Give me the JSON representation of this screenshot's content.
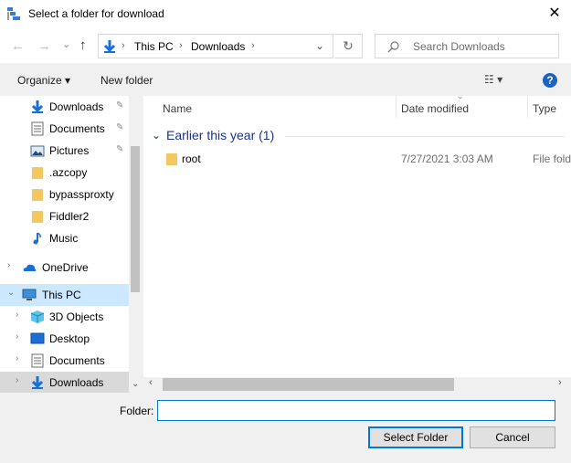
{
  "window": {
    "title": "Select a folder for download",
    "close_glyph": "✕"
  },
  "nav": {
    "back_glyph": "←",
    "forward_glyph": "→",
    "recent_glyph": "⌄",
    "up_glyph": "↑",
    "breadcrumb": [
      "This PC",
      "Downloads"
    ],
    "dropdown_glyph": "⌄",
    "refresh_glyph": "↻",
    "search_placeholder": "Search Downloads"
  },
  "commands": {
    "organize": "Organize ▾",
    "new_folder": "New folder",
    "view_glyph": "☷ ▾",
    "help": "?"
  },
  "sidebar": {
    "items": [
      {
        "label": "Downloads",
        "icon": "download-icon",
        "pinned": true
      },
      {
        "label": "Documents",
        "icon": "documents-icon",
        "pinned": true
      },
      {
        "label": "Pictures",
        "icon": "pictures-icon",
        "pinned": true
      },
      {
        "label": ".azcopy",
        "icon": "folder-icon",
        "pinned": false
      },
      {
        "label": "bypassproxty",
        "icon": "folder-icon",
        "pinned": false
      },
      {
        "label": "Fiddler2",
        "icon": "folder-icon",
        "pinned": false
      },
      {
        "label": "Music",
        "icon": "music-icon",
        "pinned": false
      },
      {
        "label": "OneDrive",
        "icon": "onedrive-icon",
        "pinned": false
      },
      {
        "label": "This PC",
        "icon": "computer-icon",
        "pinned": false
      },
      {
        "label": "3D Objects",
        "icon": "3d-objects-icon",
        "pinned": false
      },
      {
        "label": "Desktop",
        "icon": "desktop-icon",
        "pinned": false
      },
      {
        "label": "Documents",
        "icon": "documents-icon",
        "pinned": false
      },
      {
        "label": "Downloads",
        "icon": "download-icon",
        "pinned": false
      }
    ],
    "pin_glyph": "📌",
    "expand_glyph": "›",
    "expanded_glyph": "⌄"
  },
  "columns": {
    "name": "Name",
    "date_modified": "Date modified",
    "type": "Type"
  },
  "group": {
    "label": "Earlier this year (1)",
    "chevron": "⌄"
  },
  "files": [
    {
      "name": "root",
      "date": "7/27/2021 3:03 AM",
      "type": "File fold"
    }
  ],
  "footer": {
    "folder_label": "Folder:",
    "folder_value": "",
    "select_label": "Select Folder",
    "cancel_label": "Cancel"
  },
  "colors": {
    "accent": "#0078d7",
    "selection": "#cce8ff",
    "group_header": "#1e3287",
    "folder_yellow": "#f4c860"
  }
}
